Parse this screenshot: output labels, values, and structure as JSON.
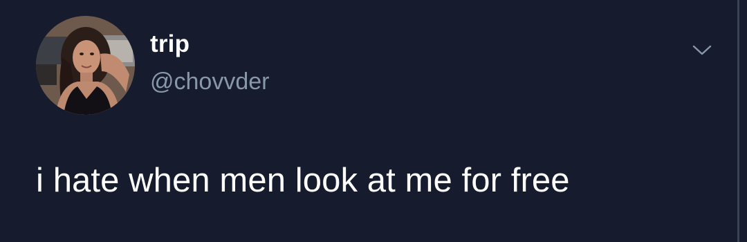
{
  "tweet": {
    "author": {
      "display_name": "trip",
      "handle": "@chovvder",
      "avatar_icon": "profile-photo"
    },
    "text": "i hate when men look at me for free",
    "menu_icon": "chevron-down-icon"
  },
  "colors": {
    "background": "#161b2e",
    "text_primary": "#ffffff",
    "text_secondary": "#8898aa"
  }
}
